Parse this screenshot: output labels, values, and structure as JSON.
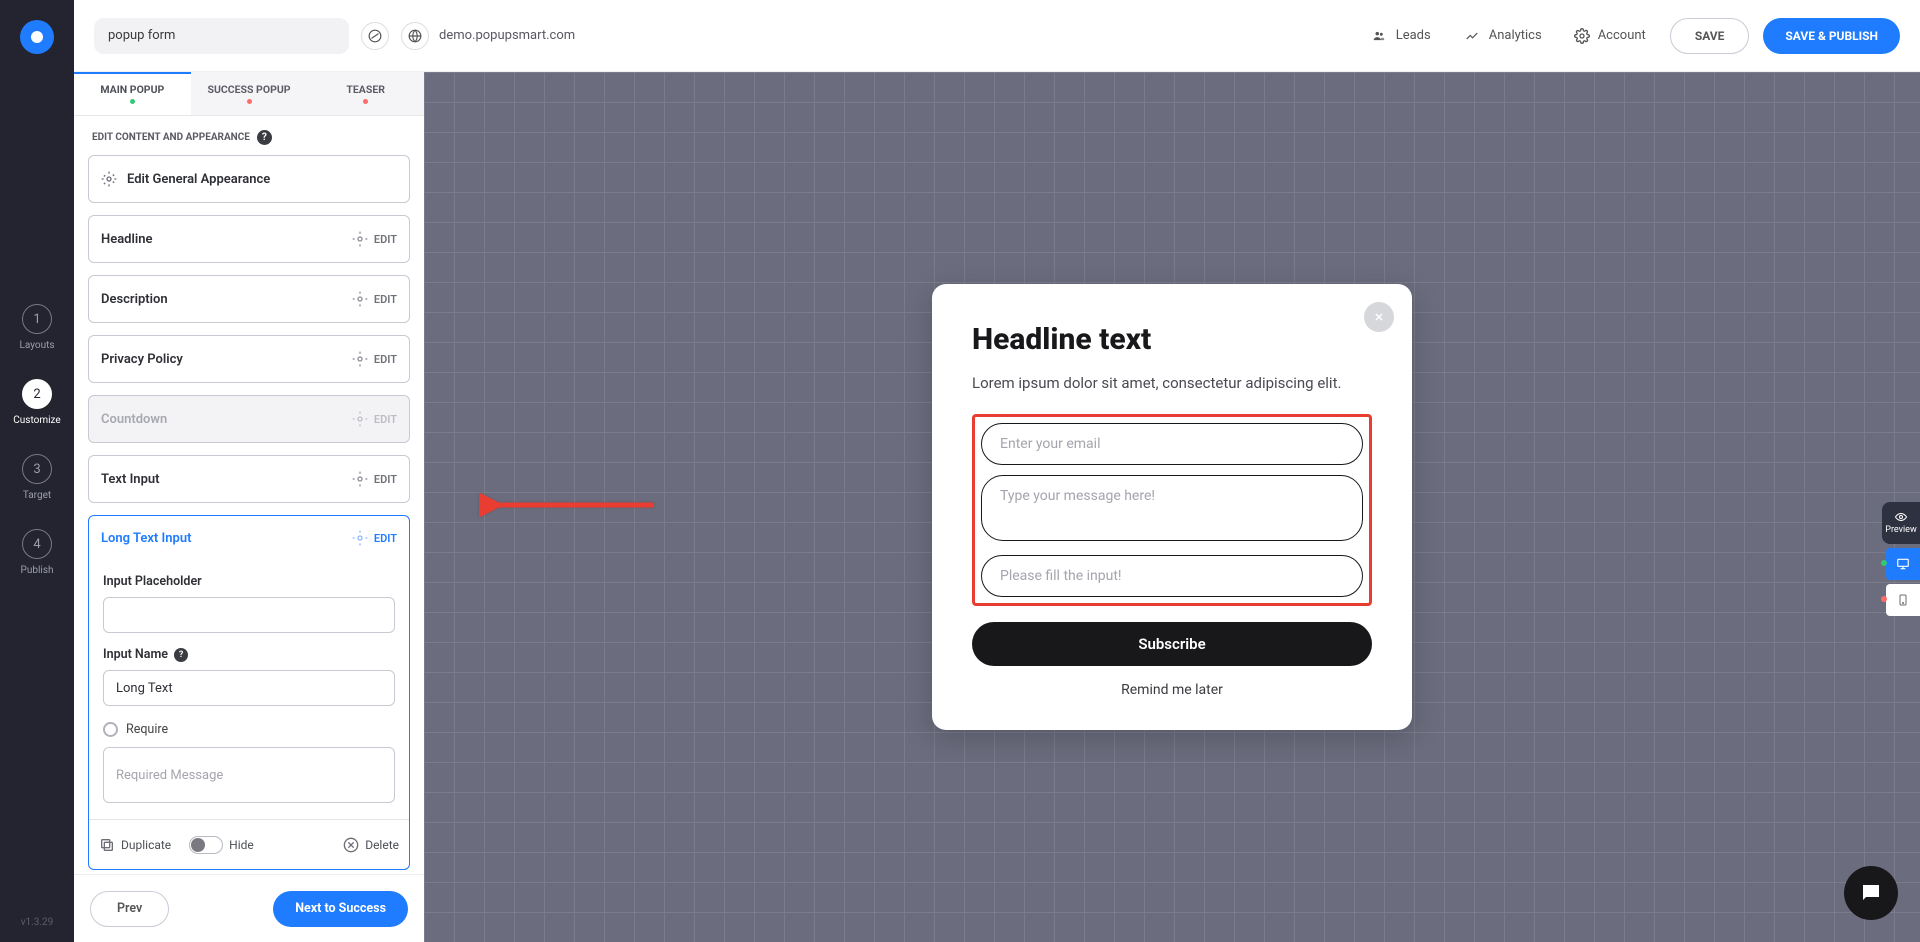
{
  "topbar": {
    "campaign_name": "popup form",
    "domain": "demo.popupsmart.com",
    "links": {
      "leads": "Leads",
      "analytics": "Analytics",
      "account": "Account"
    },
    "save": "SAVE",
    "publish": "SAVE & PUBLISH"
  },
  "steps": [
    {
      "num": "1",
      "label": "Layouts"
    },
    {
      "num": "2",
      "label": "Customize"
    },
    {
      "num": "3",
      "label": "Target"
    },
    {
      "num": "4",
      "label": "Publish"
    }
  ],
  "version": "v1.3.29",
  "tabs": {
    "main": "MAIN POPUP",
    "success": "SUCCESS POPUP",
    "teaser": "TEASER"
  },
  "section_header": "EDIT CONTENT AND APPEARANCE",
  "blocks": {
    "general": "Edit General Appearance",
    "headline": "Headline",
    "description": "Description",
    "privacy": "Privacy Policy",
    "countdown": "Countdown",
    "textinput": "Text Input",
    "longtext_title": "Long Text Input",
    "edit": "EDIT"
  },
  "longtext": {
    "placeholder_label": "Input Placeholder",
    "placeholder_value": "",
    "name_label": "Input Name",
    "name_value": "Long Text",
    "require_label": "Require",
    "required_msg_placeholder": "Required Message"
  },
  "card_footer": {
    "duplicate": "Duplicate",
    "hide": "Hide",
    "delete": "Delete"
  },
  "footer": {
    "prev": "Prev",
    "next": "Next to Success"
  },
  "popup": {
    "headline": "Headline text",
    "description": "Lorem ipsum dolor sit amet, consectetur adipiscing elit.",
    "email_placeholder": "Enter your email",
    "message_placeholder": "Type your message here!",
    "fill_placeholder": "Please fill the input!",
    "submit": "Subscribe",
    "remind": "Remind me later"
  },
  "preview_label": "Preview"
}
